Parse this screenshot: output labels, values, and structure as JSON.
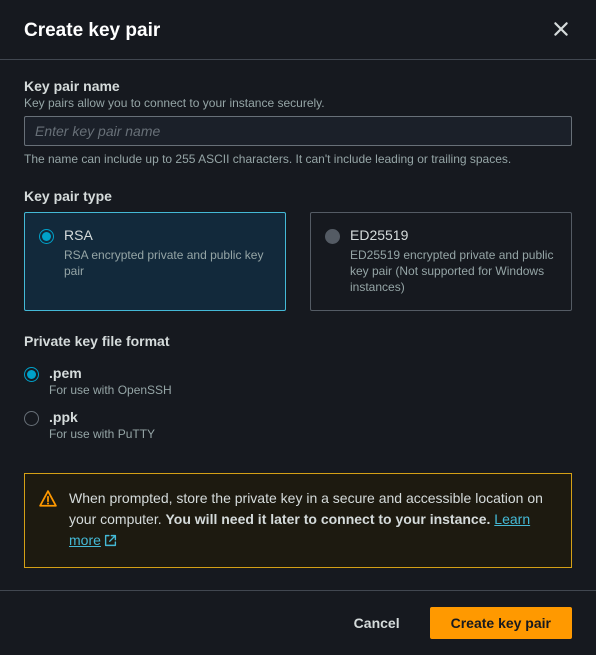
{
  "header": {
    "title": "Create key pair"
  },
  "name_field": {
    "label": "Key pair name",
    "description": "Key pairs allow you to connect to your instance securely.",
    "placeholder": "Enter key pair name",
    "value": "",
    "constraint": "The name can include up to 255 ASCII characters. It can't include leading or trailing spaces."
  },
  "type_field": {
    "label": "Key pair type",
    "options": [
      {
        "title": "RSA",
        "desc": "RSA encrypted private and public key pair",
        "selected": true
      },
      {
        "title": "ED25519",
        "desc": "ED25519 encrypted private and public key pair (Not supported for Windows instances)",
        "selected": false
      }
    ]
  },
  "format_field": {
    "label": "Private key file format",
    "options": [
      {
        "title": ".pem",
        "desc": "For use with OpenSSH",
        "selected": true
      },
      {
        "title": ".ppk",
        "desc": "For use with PuTTY",
        "selected": false
      }
    ]
  },
  "alert": {
    "text_a": "When prompted, store the private key in a secure and accessible location on your computer. ",
    "text_b": "You will need it later to connect to your instance.",
    "learn_more": "Learn more"
  },
  "footer": {
    "cancel": "Cancel",
    "submit": "Create key pair"
  }
}
